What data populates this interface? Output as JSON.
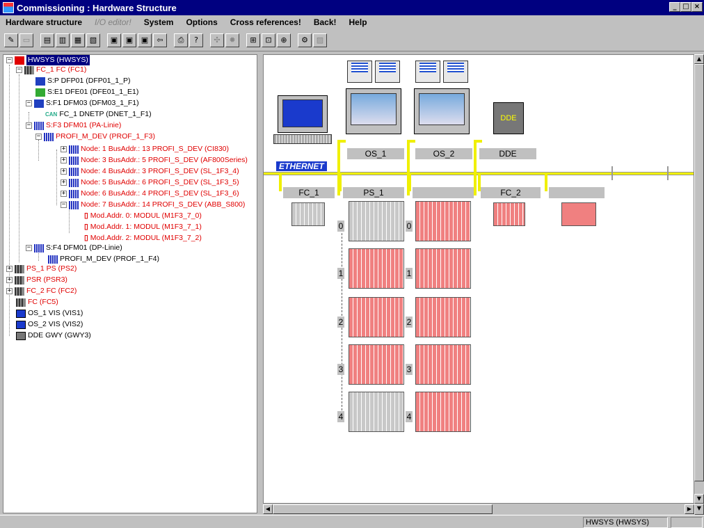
{
  "window": {
    "title": "Commissioning : Hardware Structure"
  },
  "menu": [
    {
      "label": "Hardware structure",
      "enabled": true
    },
    {
      "label": "I/O editor!",
      "enabled": false
    },
    {
      "label": "System",
      "enabled": true
    },
    {
      "label": "Options",
      "enabled": true
    },
    {
      "label": "Cross references!",
      "enabled": true
    },
    {
      "label": "Back!",
      "enabled": true
    },
    {
      "label": "Help",
      "enabled": true
    }
  ],
  "tree": [
    {
      "text": "HWSYS (HWSYS)",
      "selected": true,
      "color": "blue"
    },
    {
      "text": "FC_1  FC (FC1)",
      "color": "red"
    },
    {
      "text": "S:P  DFP01 (DFP01_1_P)",
      "color": "black"
    },
    {
      "text": "S:E1  DFE01 (DFE01_1_E1)",
      "color": "black"
    },
    {
      "text": "S:F1  DFM03 (DFM03_1_F1)",
      "color": "black"
    },
    {
      "text": "FC_1   DNETP (DNET_1_F1)",
      "color": "black"
    },
    {
      "text": "S:F3  DFM01 (PA-Linie)",
      "color": "red"
    },
    {
      "text": "PROFI_M_DEV (PROF_1_F3)",
      "color": "red"
    },
    {
      "text": "Node: 1 BusAddr.: 13 PROFI_S_DEV (CI830)",
      "color": "red"
    },
    {
      "text": "Node: 3 BusAddr.: 5 PROFI_S_DEV (AF800Series)",
      "color": "red"
    },
    {
      "text": "Node: 4 BusAddr.: 3 PROFI_S_DEV (SL_1F3_4)",
      "color": "red"
    },
    {
      "text": "Node: 5 BusAddr.: 6 PROFI_S_DEV (SL_1F3_5)",
      "color": "red"
    },
    {
      "text": "Node: 6 BusAddr.: 4 PROFI_S_DEV (SL_1F3_6)",
      "color": "red"
    },
    {
      "text": "Node: 7 BusAddr.: 14 PROFI_S_DEV (ABB_S800)",
      "color": "red"
    },
    {
      "text": "Mod.Addr. 0: MODUL (M1F3_7_0)",
      "color": "red"
    },
    {
      "text": "Mod.Addr. 1: MODUL (M1F3_7_1)",
      "color": "red"
    },
    {
      "text": "Mod.Addr. 2: MODUL (M1F3_7_2)",
      "color": "red"
    },
    {
      "text": "S:F4  DFM01 (DP-Linie)",
      "color": "black"
    },
    {
      "text": "PROFI_M_DEV (PROF_1_F4)",
      "color": "black"
    },
    {
      "text": "PS_1  PS (PS2)",
      "color": "red"
    },
    {
      "text": "PSR (PSR3)",
      "color": "red"
    },
    {
      "text": "FC_2  FC (FC2)",
      "color": "red"
    },
    {
      "text": "FC (FC5)",
      "color": "red"
    },
    {
      "text": "OS_1  VIS (VIS1)",
      "color": "black"
    },
    {
      "text": "OS_2  VIS (VIS2)",
      "color": "black"
    },
    {
      "text": "DDE  GWY (GWY3)",
      "color": "black"
    }
  ],
  "diagram": {
    "ethernet_label": "ETHERNET",
    "stations_top": [
      "OS_1",
      "OS_2",
      "DDE"
    ],
    "dde_screen": "DDE",
    "bus_labels": [
      "FC_1",
      "PS_1",
      "",
      "FC_2",
      ""
    ],
    "rack_rows": [
      "0",
      "1",
      "2",
      "3",
      "4"
    ],
    "rack_rows_right": [
      "0",
      "1",
      "2",
      "3",
      "4"
    ]
  },
  "status": {
    "text": "HWSYS (HWSYS)"
  },
  "colors": {
    "titlebar": "#000080",
    "bus": "#f0f000",
    "tree_red": "#e00000",
    "rack_red": "#f08080"
  }
}
